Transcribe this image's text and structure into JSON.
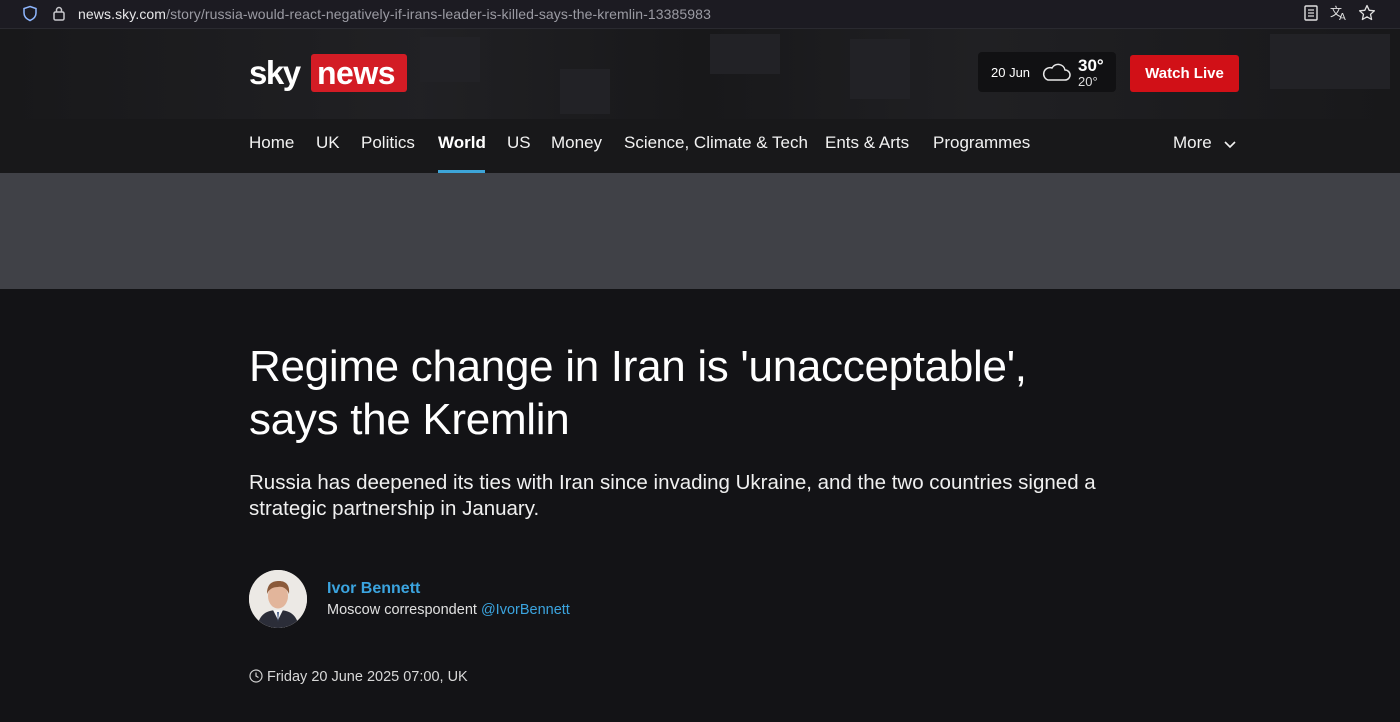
{
  "browser": {
    "url_domain": "news.sky.com",
    "url_path": "/story/russia-would-react-negatively-if-irans-leader-is-killed-says-the-kremlin-13385983"
  },
  "header": {
    "logo_sky": "sky",
    "logo_news": "news",
    "weather": {
      "date": "20 Jun",
      "high": "30°",
      "low": "20°",
      "icon": "cloud-icon"
    },
    "watch_live_label": "Watch Live",
    "nav": [
      "Home",
      "UK",
      "Politics",
      "World",
      "US",
      "Money",
      "Science, Climate & Tech",
      "Ents & Arts",
      "Programmes"
    ],
    "active_nav": "World",
    "more_label": "More"
  },
  "article": {
    "headline_line1": "Regime change in Iran is 'unacceptable',",
    "headline_line2": "says the Kremlin",
    "standfirst": "Russia has deepened its ties with Iran since invading Ukraine, and the two countries signed a strategic partnership in January.",
    "author": {
      "name": "Ivor Bennett",
      "role": "Moscow correspondent",
      "handle": "@IvorBennett"
    },
    "timestamp": "Friday 20 June 2025 07:00, UK"
  },
  "colors": {
    "brand_red": "#d31c25",
    "watch_live_red": "#d11017",
    "link_blue": "#3ba4df",
    "nav_active_underline": "#3da5d9",
    "page_bg": "#131316"
  }
}
